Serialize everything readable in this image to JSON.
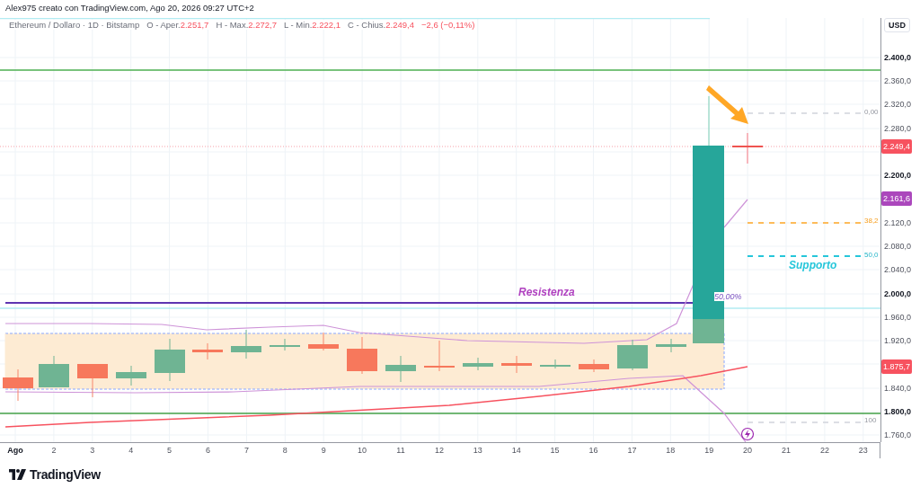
{
  "header": {
    "attribution": "Alex975 creato con TradingView.com, Ago 20, 2026 09:27 UTC+2"
  },
  "legend": {
    "symbol": "Ethereum / Dollaro · 1D · Bitstamp",
    "values": [
      {
        "label": "O - Aper.",
        "value": "2.251,7"
      },
      {
        "label": "H - Max.",
        "value": "2.272,7"
      },
      {
        "label": "L - Min.",
        "value": "2.222,1"
      },
      {
        "label": "C - Chius.",
        "value": "2.249,4"
      }
    ],
    "change": "−2,6 (−0,11%)"
  },
  "annotations": [
    {
      "kind": "resistance",
      "text": "Resistenza"
    },
    {
      "kind": "support",
      "text": "Supporto"
    },
    {
      "kind": "ratio",
      "text": "50,00%"
    }
  ],
  "fib_labels": [
    "0,00",
    "38,2",
    "50,0",
    "100"
  ],
  "price_axis": {
    "currency": "USD",
    "ticks": [
      {
        "label": "2.400,0",
        "major": true
      },
      {
        "label": "2.360,0",
        "major": false
      },
      {
        "label": "2.320,0",
        "major": false
      },
      {
        "label": "2.280,0",
        "major": false
      },
      {
        "label": "2.200,0",
        "major": true
      },
      {
        "label": "2.120,0",
        "major": false
      },
      {
        "label": "2.080,0",
        "major": false
      },
      {
        "label": "2.040,0",
        "major": false
      },
      {
        "label": "2.000,0",
        "major": true
      },
      {
        "label": "1.960,0",
        "major": false
      },
      {
        "label": "1.920,0",
        "major": false
      },
      {
        "label": "1.840,0",
        "major": false
      },
      {
        "label": "1.800,0",
        "major": true
      },
      {
        "label": "1.760,0",
        "major": false
      }
    ],
    "tags": [
      {
        "label": "2.249,4",
        "color": "#f7525f"
      },
      {
        "label": "2.161,6",
        "color": "#ab47bc"
      },
      {
        "label": "1.875,7",
        "color": "#f7525f"
      }
    ]
  },
  "time_axis": [
    "Ago",
    "2",
    "3",
    "4",
    "5",
    "6",
    "7",
    "8",
    "9",
    "10",
    "11",
    "12",
    "13",
    "14",
    "15",
    "16",
    "17",
    "18",
    "19",
    "20",
    "21",
    "22",
    "23"
  ],
  "footer": {
    "logo": "TradingView"
  }
}
